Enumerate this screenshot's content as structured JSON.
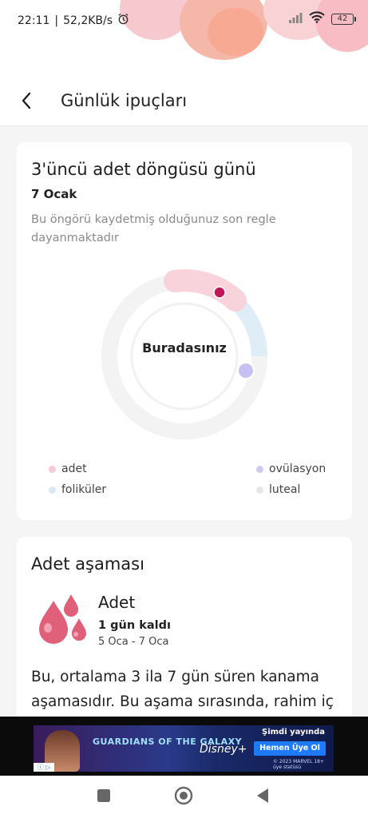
{
  "status_bar": {
    "time": "22:11",
    "network_speed": "52,2KB/s",
    "alarm_icon": "alarm-icon",
    "battery_level": "42"
  },
  "header": {
    "back_icon": "chevron-left-icon",
    "title": "Günlük ipuçları"
  },
  "cycle_card": {
    "title": "3'üncü adet döngüsü günü",
    "date": "7 Ocak",
    "note": "Bu öngörü kaydetmiş olduğunuz son regle dayanmaktadır",
    "ring_center_label": "Buradasınız",
    "legend": [
      {
        "label": "adet",
        "color": "#f8c9d3"
      },
      {
        "label": "ovülasyon",
        "color": "#cfc8f3"
      },
      {
        "label": "foliküler",
        "color": "#d6e9f4"
      },
      {
        "label": "luteal",
        "color": "#e6e6ea"
      }
    ],
    "colors": {
      "period": "#f8d3dc",
      "follicular": "#deedf6",
      "luteal": "#f2f2f2",
      "marker": "#c2185b",
      "ovulation": "#c7c0f2"
    }
  },
  "phase_card": {
    "title": "Adet aşaması",
    "phase_name": "Adet",
    "remaining": "1 gün kaldı",
    "date_range": "5 Oca - 7 Oca",
    "description": "Bu, ortalama 3 ila 7 gün süren kanama aşamasıdır. Bu aşama sırasında, rahim iç"
  },
  "ad": {
    "title": "GUARDIANS OF THE GALAXY",
    "brand": "Disney+",
    "cta_top": "Şimdi yayında",
    "cta_button": "Hemen Üye Ol",
    "fine_print": "© 2023 MARVEL 18+ üye statüsü"
  },
  "nav": {
    "recent_icon": "square-icon",
    "home_icon": "circle-home-icon",
    "back_icon": "triangle-back-icon"
  }
}
